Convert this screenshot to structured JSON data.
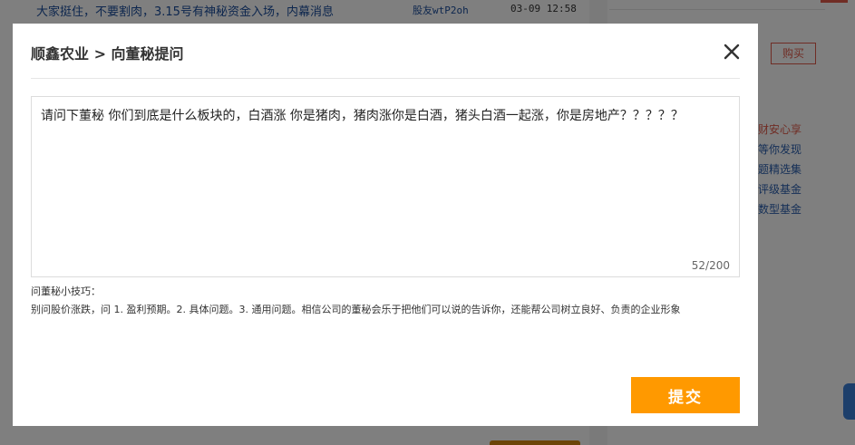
{
  "background": {
    "top_post": {
      "title": "大家挺住，不要割肉，3.15号有神秘资金入场，内幕消息",
      "user": "股友wtP2oh",
      "time": "03-09 12:58"
    },
    "buy_label": "购买",
    "side_links": [
      "财安心享",
      "等你发现",
      "题精选集",
      "评级基金",
      "数型基金"
    ],
    "colors": {
      "link_blue": "#1a4d9c",
      "accent_red": "#e05a4a"
    }
  },
  "modal": {
    "title": "顺鑫农业 > 向董秘提问",
    "close_icon": "close-icon",
    "question": {
      "value": "请问下董秘 你们到底是什么板块的，白酒涨 你是猪肉，猪肉涨你是白酒，猪头白酒一起涨，你是房地产？？？？？",
      "char_count": "52/200"
    },
    "tips": {
      "title": "问董秘小技巧：",
      "body": "别问股价涨跌，问 1. 盈利预期。2. 具体问题。3. 通用问题。相信公司的董秘会乐于把他们可以说的告诉你，还能帮公司树立良好、负责的企业形象"
    },
    "submit_label": "提交",
    "colors": {
      "submit": "#ff9900"
    }
  }
}
